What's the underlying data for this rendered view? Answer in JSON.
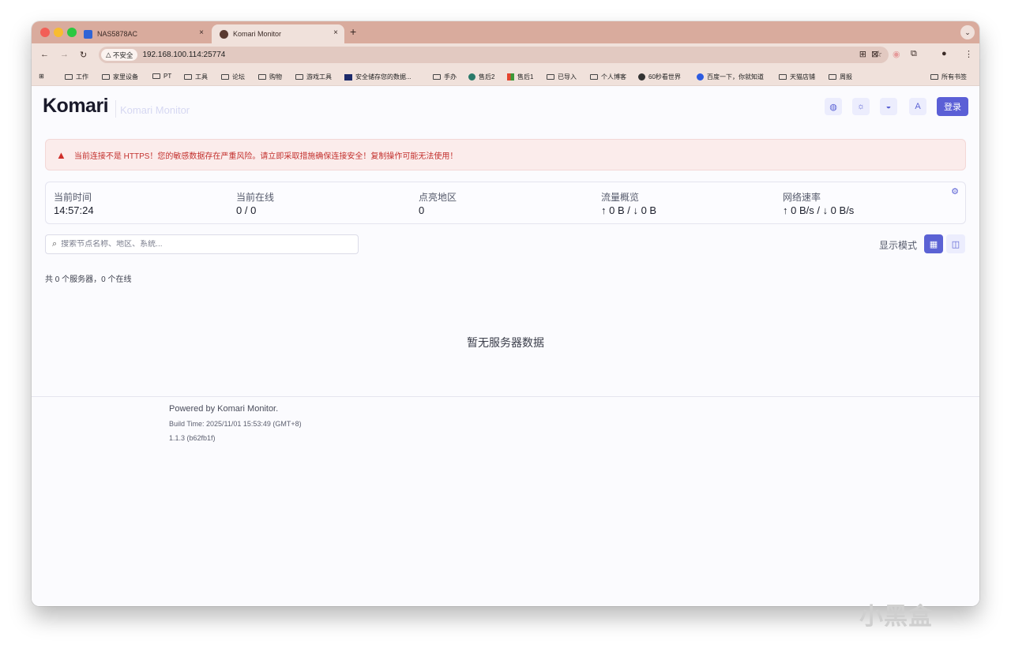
{
  "browser": {
    "tabs": [
      {
        "title": "NAS5878AC",
        "fav_color": "#2f64d6"
      },
      {
        "title": "Komari Monitor",
        "fav_color": "#5a3a30"
      }
    ],
    "tab_close": "×",
    "new_tab": "+",
    "security_label": "不安全",
    "url": "192.168.100.114:25774",
    "bookmarks": [
      "工作",
      "家里设备",
      "PT",
      "工具",
      "论坛",
      "购物",
      "游戏工具",
      "安全储存您的数据...",
      "手办",
      "售后2",
      "售后1",
      "已导入",
      "个人博客",
      "60秒看世界",
      "百度一下，你就知道",
      "天猫店铺",
      "周报",
      "所有书签"
    ]
  },
  "header": {
    "logo": "Komari",
    "subtitle": "Komari Monitor",
    "login_label": "登录"
  },
  "alert": {
    "text": "当前连接不是 HTTPS！您的敏感数据存在严重风险。请立即采取措施确保连接安全！复制操作可能无法使用！",
    "color": "#c3302d"
  },
  "stats": [
    {
      "label": "当前时间",
      "value": "14:57:24"
    },
    {
      "label": "当前在线",
      "value": "0 / 0"
    },
    {
      "label": "点亮地区",
      "value": "0"
    },
    {
      "label": "流量概览",
      "value": "↑ 0 B / ↓ 0 B"
    },
    {
      "label": "网络速率",
      "value": "↑ 0 B/s / ↓ 0 B/s"
    }
  ],
  "search": {
    "placeholder": "搜索节点名称、地区、系统..."
  },
  "view_mode": {
    "label": "显示模式"
  },
  "server_count": "共 0 个服务器，0 个在线",
  "empty_message": "暂无服务器数据",
  "footer": {
    "powered": "Powered by Komari Monitor.",
    "build_time": "Build Time: 2025/11/01 15:53:49 (GMT+8)",
    "version": "1.1.3 (b62fb1f)"
  },
  "watermark": "小黑盒",
  "accent_color": "#5b62d4"
}
